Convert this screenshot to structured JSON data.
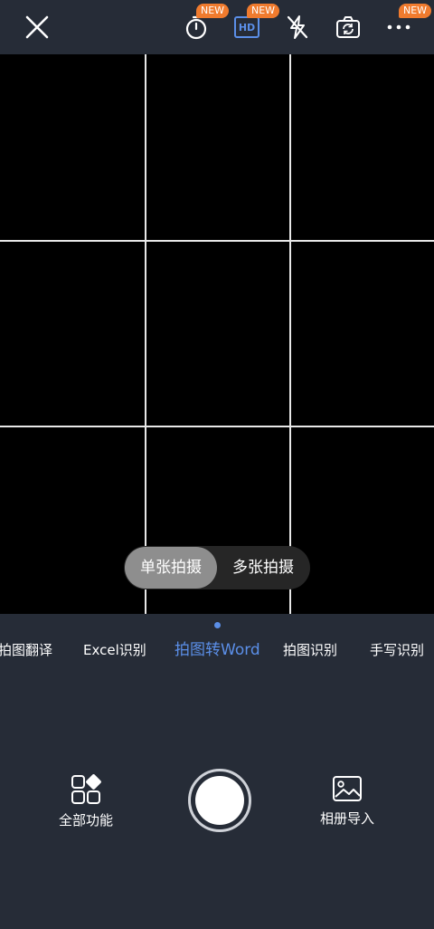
{
  "topbar": {
    "timer_badge": "NEW",
    "hd_label": "HD",
    "hd_badge": "NEW",
    "more_badge": "NEW"
  },
  "mode_toggle": {
    "single": "单张拍摄",
    "multi": "多张拍摄"
  },
  "tabs": [
    {
      "label": "拍图翻译"
    },
    {
      "label": "Excel识别"
    },
    {
      "label": "拍图转Word"
    },
    {
      "label": "拍图识别"
    },
    {
      "label": "手写识别"
    }
  ],
  "bottom": {
    "all_functions": "全部功能",
    "album_import": "相册导入"
  },
  "colors": {
    "accent": "#5b8fe8",
    "badge": "#f07b2e",
    "background": "#262c37"
  },
  "icons": [
    "close-icon",
    "timer-icon",
    "hd-icon",
    "flash-off-icon",
    "switch-camera-icon",
    "more-icon",
    "grid-apps-icon",
    "image-icon"
  ]
}
